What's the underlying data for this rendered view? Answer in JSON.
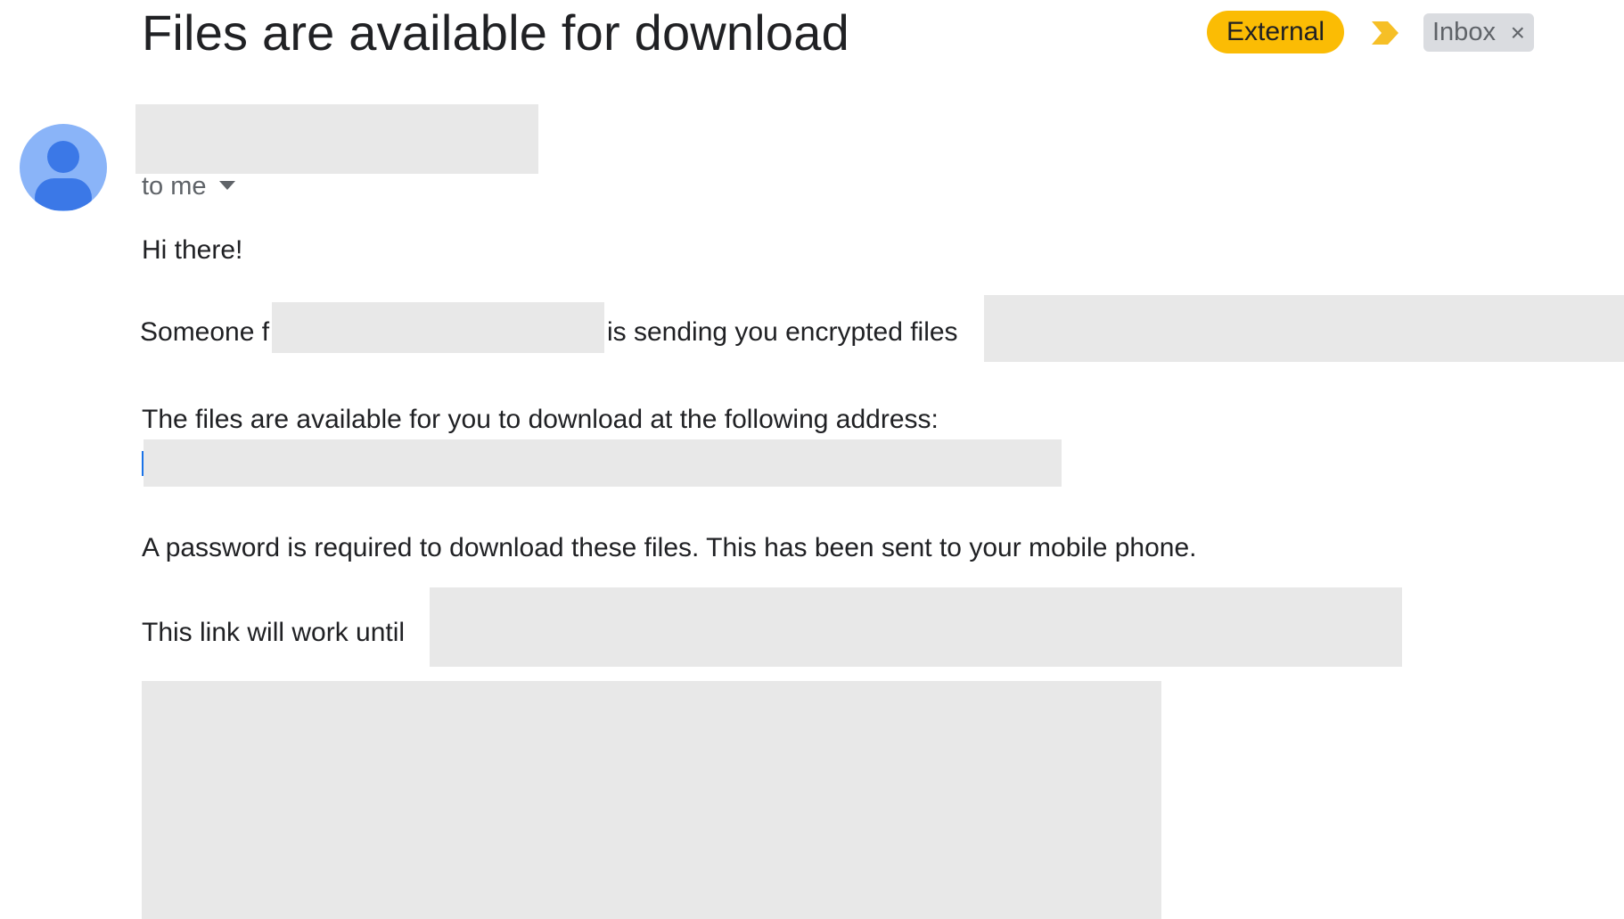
{
  "email": {
    "subject": "Files are available for download",
    "labels": {
      "external": "External",
      "inbox": "Inbox",
      "inbox_remove": "×"
    },
    "recipient": "to me",
    "body": {
      "greeting": "Hi there!",
      "someone_prefix": "Someone f",
      "sending_text": "is sending you encrypted files",
      "address_intro": "The files are available for you to download at the following address:",
      "password_note": "A password is required to download these files. This has been sent to your mobile phone.",
      "link_expiry": "This link will work until"
    }
  },
  "icons": {
    "avatar": "person-icon",
    "importance": "importance-marker-icon",
    "recipient_details": "chevron-down-icon",
    "remove_label": "close-icon"
  },
  "colors": {
    "external_label": "#fbbc04",
    "importance_marker": "#f6bf26",
    "inbox_label_bg": "#dadce0",
    "avatar_bg": "#8ab4f8",
    "avatar_fg": "#3b78e7",
    "redaction": "#e8e8e8"
  }
}
